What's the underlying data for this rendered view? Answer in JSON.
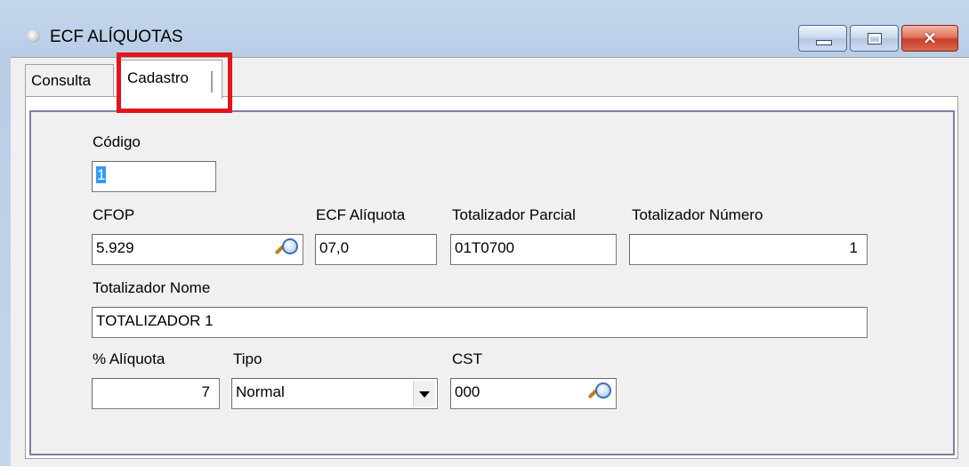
{
  "window": {
    "title": "ECF ALÍQUOTAS",
    "icon": "app-orb-icon",
    "controls": {
      "minimize": "minimize-icon",
      "maximize": "maximize-icon",
      "close": "×"
    }
  },
  "tabs": [
    {
      "label": "Consulta",
      "active": false
    },
    {
      "label": "Cadastro",
      "active": true
    }
  ],
  "highlight_color": "#e3131b",
  "form": {
    "codigo": {
      "label": "Código",
      "value": "1"
    },
    "cfop": {
      "label": "CFOP",
      "value": "5.929"
    },
    "ecf_aliquota": {
      "label": "ECF Alíquota",
      "value": "07,0"
    },
    "totalizador_parcial": {
      "label": "Totalizador Parcial",
      "value": "01T0700"
    },
    "totalizador_numero": {
      "label": "Totalizador Número",
      "value": "1"
    },
    "totalizador_nome": {
      "label": "Totalizador Nome",
      "value": "TOTALIZADOR 1"
    },
    "percent_aliquota": {
      "label": "% Alíquota",
      "value": "7"
    },
    "tipo": {
      "label": "Tipo",
      "value": "Normal"
    },
    "cst": {
      "label": "CST",
      "value": "000"
    }
  }
}
